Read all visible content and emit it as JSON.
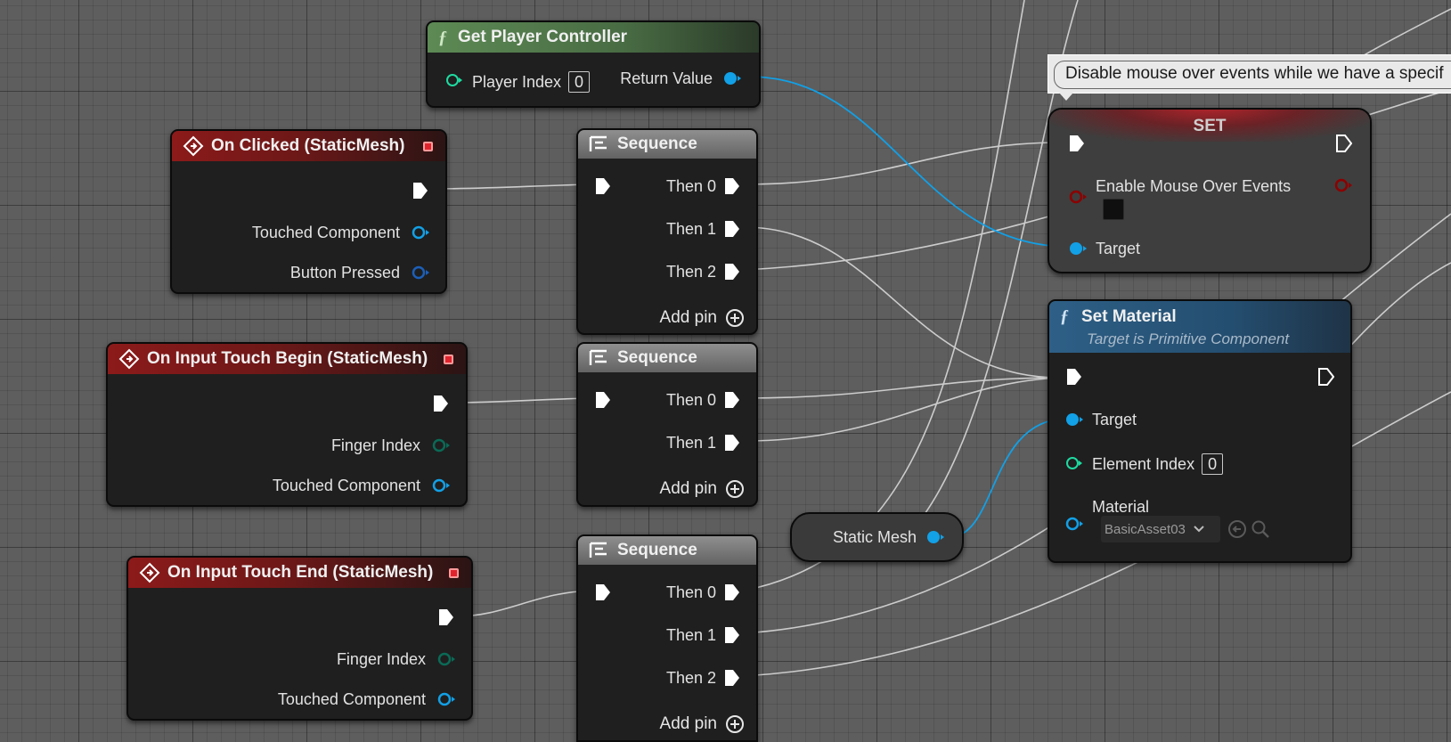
{
  "comment": {
    "text": "Disable mouse over events while we have a specif"
  },
  "nodes": {
    "get_player_controller": {
      "title": "Get Player Controller",
      "player_index_label": "Player Index",
      "player_index_value": "0",
      "return_label": "Return Value"
    },
    "on_clicked": {
      "title": "On Clicked (StaticMesh)",
      "touched_component": "Touched Component",
      "button_pressed": "Button Pressed"
    },
    "on_touch_begin": {
      "title": "On Input Touch Begin (StaticMesh)",
      "finger_index": "Finger Index",
      "touched_component": "Touched Component"
    },
    "on_touch_end": {
      "title": "On Input Touch End (StaticMesh)",
      "finger_index": "Finger Index",
      "touched_component": "Touched Component"
    },
    "sequence_1": {
      "title": "Sequence",
      "then": [
        "Then 0",
        "Then 1",
        "Then 2"
      ],
      "add_pin": "Add pin"
    },
    "sequence_2": {
      "title": "Sequence",
      "then": [
        "Then 0",
        "Then 1"
      ],
      "add_pin": "Add pin"
    },
    "sequence_3": {
      "title": "Sequence",
      "then": [
        "Then 0",
        "Then 1",
        "Then 2"
      ],
      "add_pin": "Add pin"
    },
    "set": {
      "title": "SET",
      "variable": "Enable Mouse Over Events",
      "target": "Target"
    },
    "set_material": {
      "title": "Set Material",
      "subtitle": "Target is Primitive Component",
      "target": "Target",
      "element_index_label": "Element Index",
      "element_index_value": "0",
      "material_label": "Material",
      "material_value": "BasicAsset03"
    },
    "static_mesh": {
      "label": "Static Mesh"
    }
  },
  "colors": {
    "exec_wire": "#d8d8d8",
    "object_pin": "#12a0e6",
    "bool_pin": "#8c0000",
    "int_pin": "#1edba0",
    "event_header": "#8c1a1a",
    "pure_header": "#5d8a55",
    "function_header": "#2e5f86"
  }
}
